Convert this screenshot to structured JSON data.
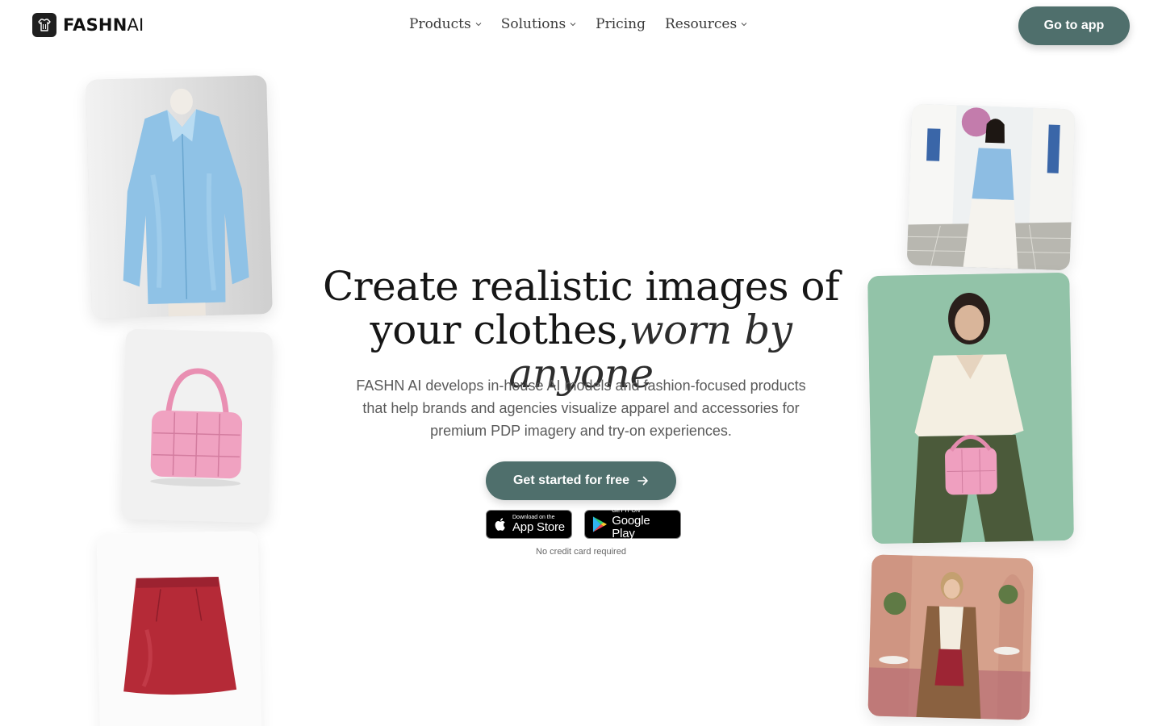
{
  "brand": {
    "name_bold": "FASHN",
    "name_light": "AI",
    "icon": "hanger-shirt-icon"
  },
  "nav": {
    "items": [
      {
        "label": "Products",
        "has_dropdown": true
      },
      {
        "label": "Solutions",
        "has_dropdown": true
      },
      {
        "label": "Pricing",
        "has_dropdown": false
      },
      {
        "label": "Resources",
        "has_dropdown": true
      }
    ],
    "cta_label": "Go to app"
  },
  "hero": {
    "title_line1": "Create realistic images of",
    "title_line2_plain": "your clothes,",
    "title_line2_italic": "worn by anyone",
    "subtitle": "FASHN AI develops in-house AI models and fashion-focused products that help brands and agencies visualize apparel and accessories for premium PDP imagery and try-on experiences.",
    "cta_label": "Get started for free",
    "app_store": {
      "small": "Download on the",
      "big": "App Store"
    },
    "google_play": {
      "small": "GET IT ON",
      "big": "Google Play"
    },
    "note": "No credit card required"
  },
  "colors": {
    "primary": "#4f6f6c",
    "text": "#161616",
    "muted": "#5a5a5a"
  }
}
